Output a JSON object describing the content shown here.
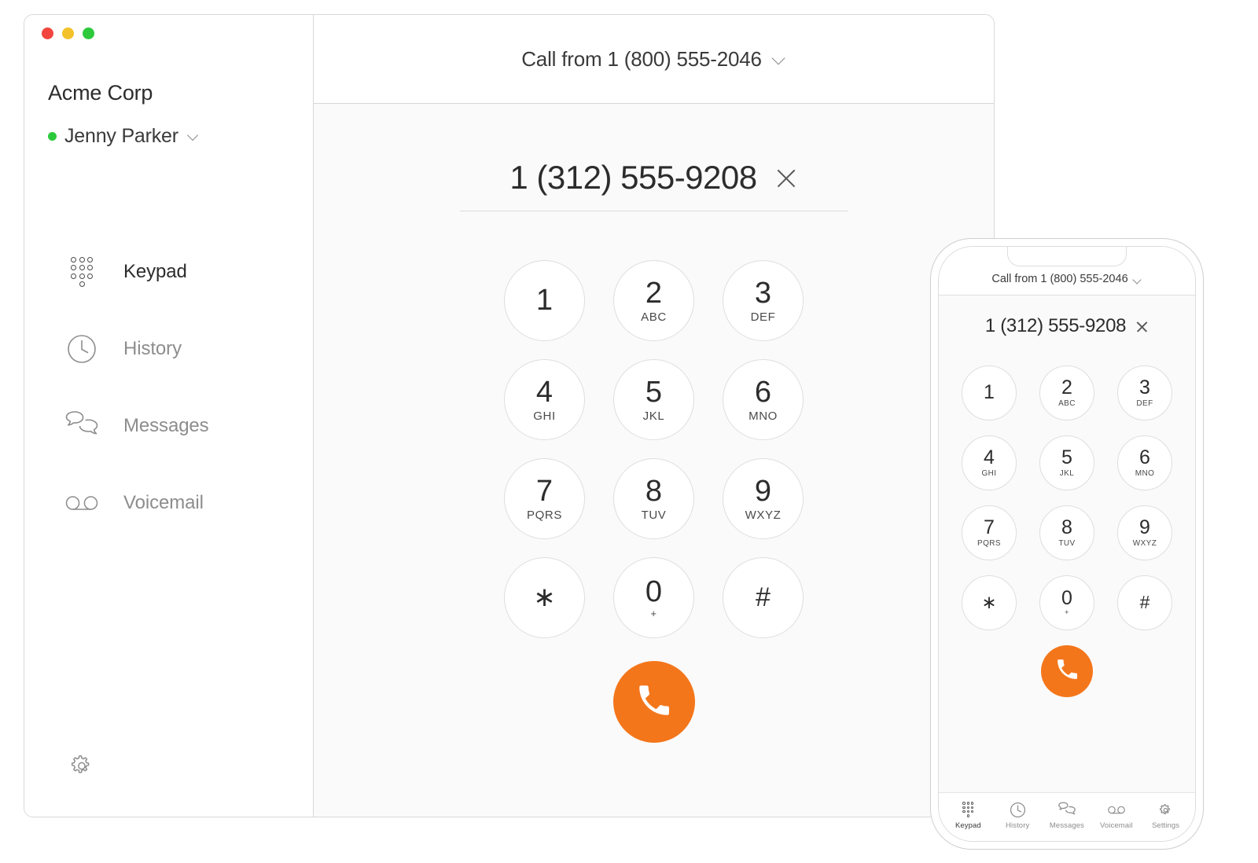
{
  "window": {
    "traffic_lights": [
      {
        "name": "close",
        "color": "#f1453d"
      },
      {
        "name": "minimize",
        "color": "#f3c129"
      },
      {
        "name": "maximize",
        "color": "#2dc93c"
      }
    ]
  },
  "sidebar": {
    "org_name": "Acme Corp",
    "user_name": "Jenny Parker",
    "presence_color": "#2dc93c",
    "items": [
      {
        "label": "Keypad",
        "icon": "keypad-icon",
        "active": true
      },
      {
        "label": "History",
        "icon": "clock-icon",
        "active": false
      },
      {
        "label": "Messages",
        "icon": "chat-bubbles-icon",
        "active": false
      },
      {
        "label": "Voicemail",
        "icon": "voicemail-icon",
        "active": false
      }
    ],
    "settings_icon": "gear-icon"
  },
  "main": {
    "call_from_label": "Call from 1 (800) 555-2046",
    "dialed_number": "1 (312) 555-9208",
    "clear_icon": "close-icon",
    "call_button_color": "#f4761b",
    "call_icon": "phone-handset-icon",
    "keys": [
      {
        "digit": "1",
        "letters": ""
      },
      {
        "digit": "2",
        "letters": "ABC"
      },
      {
        "digit": "3",
        "letters": "DEF"
      },
      {
        "digit": "4",
        "letters": "GHI"
      },
      {
        "digit": "5",
        "letters": "JKL"
      },
      {
        "digit": "6",
        "letters": "MNO"
      },
      {
        "digit": "7",
        "letters": "PQRS"
      },
      {
        "digit": "8",
        "letters": "TUV"
      },
      {
        "digit": "9",
        "letters": "WXYZ"
      },
      {
        "digit": "∗",
        "letters": ""
      },
      {
        "digit": "0",
        "letters": "+"
      },
      {
        "digit": "#",
        "letters": ""
      }
    ]
  },
  "phone": {
    "call_from_label": "Call from 1 (800) 555-2046",
    "dialed_number": "1 (312) 555-9208",
    "tabs": [
      {
        "label": "Keypad",
        "icon": "keypad-icon",
        "active": true
      },
      {
        "label": "History",
        "icon": "clock-icon",
        "active": false
      },
      {
        "label": "Messages",
        "icon": "chat-bubbles-icon",
        "active": false
      },
      {
        "label": "Voicemail",
        "icon": "voicemail-icon",
        "active": false
      },
      {
        "label": "Settings",
        "icon": "gear-icon",
        "active": false
      }
    ]
  }
}
